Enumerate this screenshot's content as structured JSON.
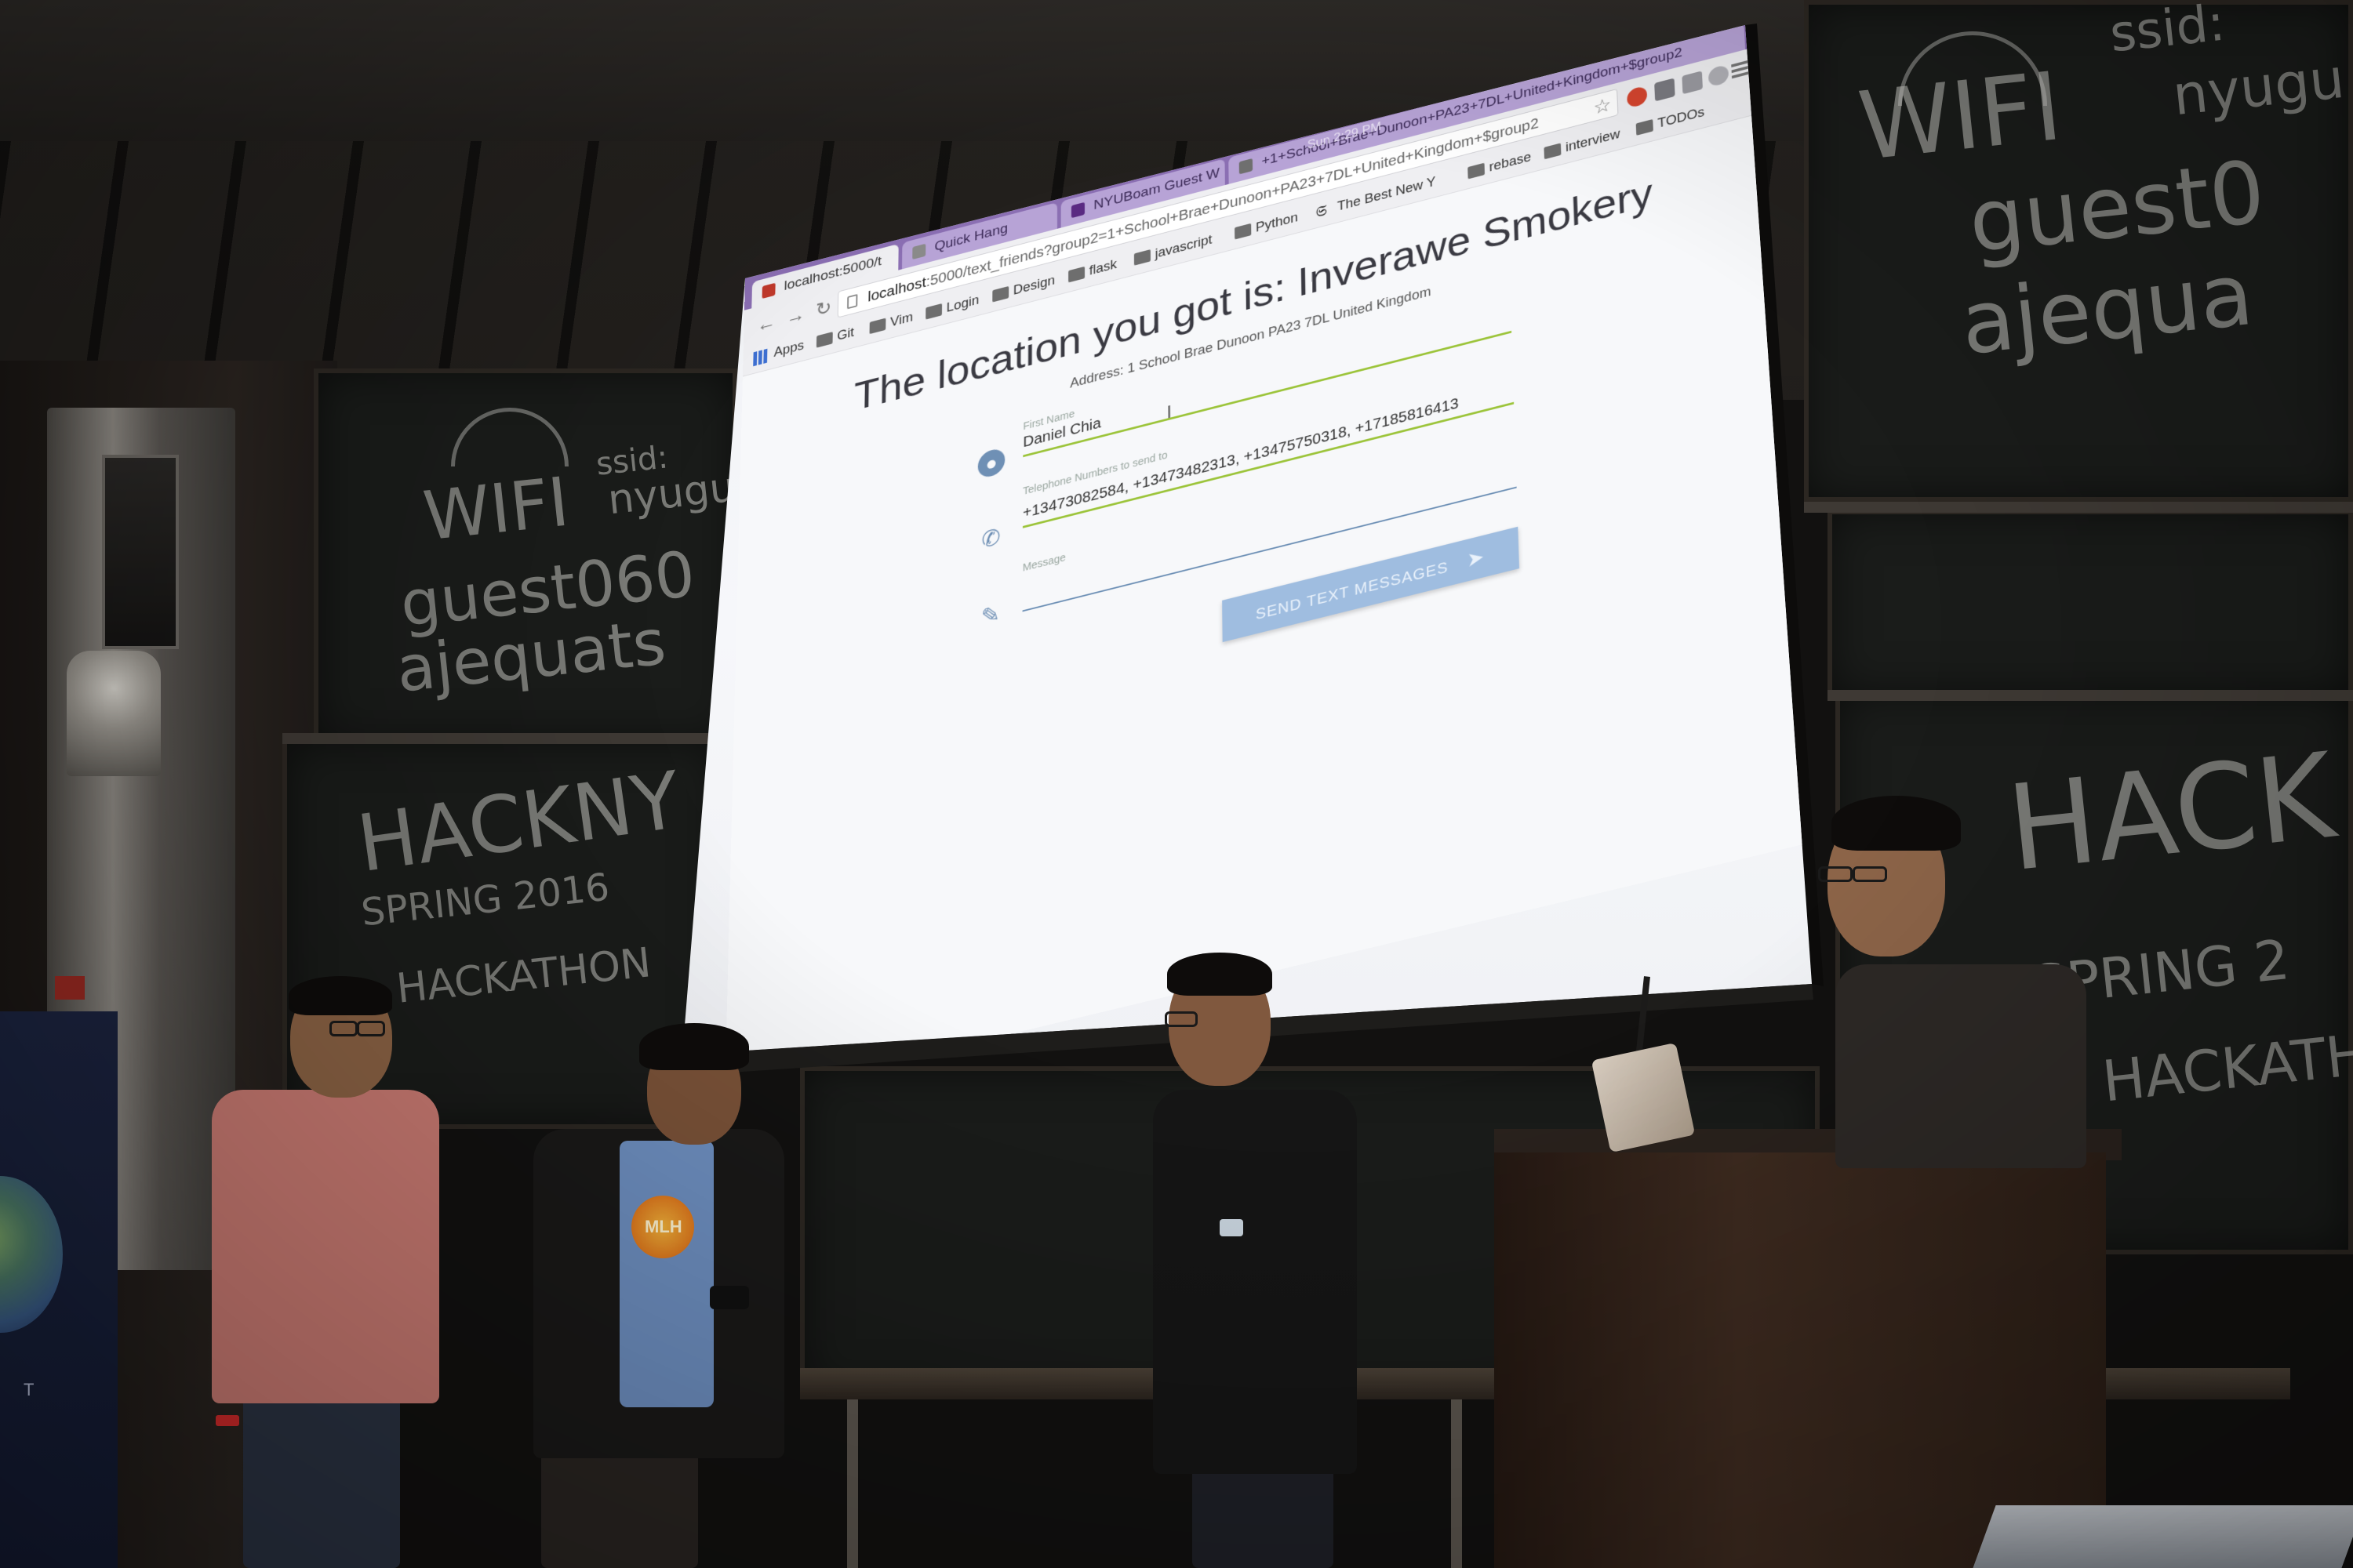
{
  "browser": {
    "tabs": [
      {
        "label": "localhost:5000/t",
        "icon": "page-icon"
      },
      {
        "label": "Quick Hang",
        "icon": "doc-icon"
      },
      {
        "label": "NYUBoam Guest W",
        "icon": "nyu-icon"
      },
      {
        "label": "+1+School+Brae+Dunoon+PA23+7DL+United+Kingdom+$group2",
        "icon": "wave-icon"
      }
    ],
    "clock": "Sun 2:29 PM",
    "url_host": "localhost",
    "url_rest": ":5000/text_friends?group2=1+School+Brae+Dunoon+PA23+7DL+United+Kingdom+$group2",
    "bookmarks": [
      {
        "label": "Apps",
        "icon": "apps-grid-icon"
      },
      {
        "label": "Git",
        "icon": "folder-icon"
      },
      {
        "label": "Vim",
        "icon": "folder-icon"
      },
      {
        "label": "Login",
        "icon": "folder-icon"
      },
      {
        "label": "Design",
        "icon": "folder-icon"
      },
      {
        "label": "flask",
        "icon": "folder-icon"
      },
      {
        "label": "javascript",
        "icon": "folder-icon"
      },
      {
        "label": "Python",
        "icon": "folder-icon"
      },
      {
        "label": "The Best New Y",
        "icon": "nyt-icon"
      },
      {
        "label": "rebase",
        "icon": "folder-icon"
      },
      {
        "label": "interview",
        "icon": "folder-icon"
      },
      {
        "label": "TODOs",
        "icon": "folder-icon"
      }
    ]
  },
  "page": {
    "title": "The location you got is: Inverawe Smokery",
    "address": "Address: 1 School Brae Dunoon PA23 7DL United Kingdom",
    "first_name_label": "First Name",
    "first_name_value": "Daniel Chia",
    "phones_label": "Telephone Numbers to send to",
    "phones_value": "+13473082584, +13473482313, +13475750318, +17185816413",
    "message_label": "Message",
    "message_value": "",
    "send_button": "SEND TEXT MESSAGES"
  },
  "chalkboard": {
    "wifi_big": "WIFI",
    "ssid_label": "ssid:",
    "ssid_value": "nyugu",
    "guest": "guest060",
    "password": "ajequats",
    "event_title": "HACKNY",
    "event_season": "SPRING 2016",
    "event_type": "HACKATHON",
    "wifi_right": "WIFI",
    "ssid_right": "ssid:",
    "nyugu_right": "nyugu",
    "guest_right": "guest0",
    "password_right": "ajequa",
    "hackny_right": "HACK",
    "spring_right": "SPRING 2",
    "hackathon_right": "HACKATH"
  },
  "shirt_logo": "MLH",
  "banner_text": "T",
  "colors": {
    "tab_bar": "#8b6fb3",
    "underline_active": "#9cc43a",
    "button": "#9fbde0",
    "icon_blue": "#6f90b5"
  }
}
